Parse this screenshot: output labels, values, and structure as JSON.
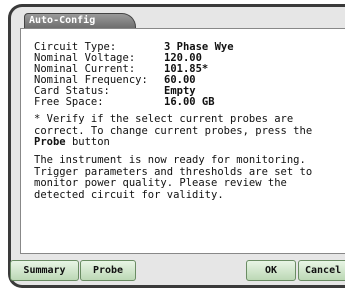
{
  "window": {
    "tab_title": "Auto-Config"
  },
  "config": {
    "rows": [
      {
        "label": "Circuit Type:",
        "value": "3 Phase Wye"
      },
      {
        "label": "Nominal Voltage:",
        "value": "120.00"
      },
      {
        "label": "Nominal Current:",
        "value": "101.85*"
      },
      {
        "label": "Nominal Frequency:",
        "value": "60.00"
      },
      {
        "label": "Card Status:",
        "value": "Empty"
      },
      {
        "label": "Free Space:",
        "value": "16.00 GB"
      }
    ]
  },
  "notes": {
    "verify_before": "* Verify if the select current probes are correct. To change current probes, press the",
    "verify_button_name": "Probe",
    "verify_after": "button",
    "ready": "The instrument is now ready for monitoring. Trigger parameters and thresholds are set to monitor power quality. Please review the detected circuit for validity."
  },
  "buttons": {
    "summary": "Summary",
    "probe": "Probe",
    "ok": "OK",
    "cancel": "Cancel"
  }
}
